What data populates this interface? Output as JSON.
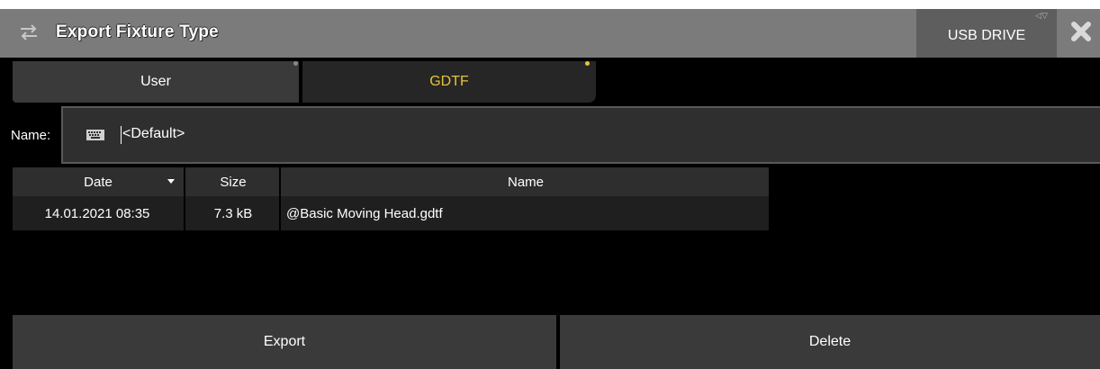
{
  "titlebar": {
    "title": "Export Fixture Type",
    "usb_label": "USB DRIVE"
  },
  "tabs": [
    {
      "label": "User",
      "active": false
    },
    {
      "label": "GDTF",
      "active": true
    }
  ],
  "name_field": {
    "label": "Name:",
    "value": "<Default>"
  },
  "table": {
    "columns": [
      "Date",
      "Size",
      "Name"
    ],
    "rows": [
      {
        "date": "14.01.2021 08:35",
        "size": "7.3 kB",
        "name": "@Basic Moving Head.gdtf"
      }
    ]
  },
  "buttons": {
    "export": "Export",
    "delete": "Delete"
  },
  "colors": {
    "titlebar": "#7b7b7b",
    "active_tab_text": "#e8c43a",
    "panel": "#3a3a3a",
    "background": "#000000"
  },
  "icons": {
    "title": "swap-arrows-icon",
    "close": "close-icon",
    "keyboard": "keyboard-icon",
    "sort": "sort-desc-icon"
  }
}
